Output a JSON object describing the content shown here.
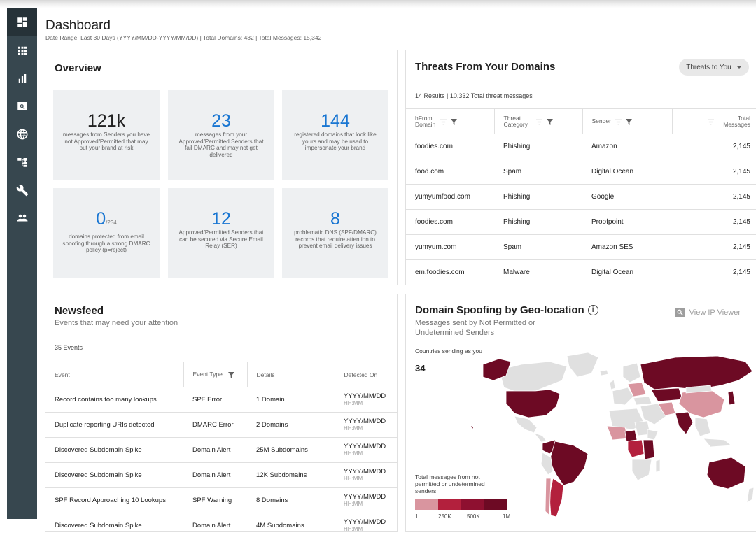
{
  "header": {
    "title": "Dashboard",
    "subtitle": "Date Range: Last 30 Days (YYYY/MM/DD-YYYY/MM/DD) | Total Domains: 432 | Total Messages: 15,342"
  },
  "sidebar": {
    "items": [
      {
        "icon": "dashboard-icon"
      },
      {
        "icon": "grid-icon"
      },
      {
        "icon": "bar-chart-icon"
      },
      {
        "icon": "search-icon"
      },
      {
        "icon": "globe-icon"
      },
      {
        "icon": "sitemap-icon"
      },
      {
        "icon": "wrench-icon"
      },
      {
        "icon": "people-icon"
      }
    ]
  },
  "overview": {
    "title": "Overview",
    "tiles": [
      {
        "value": "121k",
        "suffix": "",
        "desc": "messages from Senders you have not Approved/Permitted that may put your brand at risk"
      },
      {
        "value": "23",
        "suffix": "",
        "desc": "messages from your Approved/Permitted Senders that fail DMARC and may not get delivered"
      },
      {
        "value": "144",
        "suffix": "",
        "desc": "registered domains that look like yours and may be used to impersonate your brand"
      },
      {
        "value": "0",
        "suffix": "/234",
        "desc": "domains protected from email spoofing through a strong DMARC policy (p=reject)"
      },
      {
        "value": "12",
        "suffix": "",
        "desc": "Approved/Permitted Senders that can be secured via Secure Email Relay (SER)"
      },
      {
        "value": "8",
        "suffix": "",
        "desc": "problematic DNS (SPF/DMARC) records that require attention to prevent email delivery issues"
      }
    ]
  },
  "threats": {
    "title": "Threats From Your Domains",
    "dropdown": "Threats to You",
    "results": "14 Results | 10,332 Total threat messages",
    "columns": [
      "hFrom Domain",
      "Threat Category",
      "Sender",
      "Total Messages"
    ],
    "rows": [
      [
        "foodies.com",
        "Phishing",
        "Amazon",
        "2,145"
      ],
      [
        "food.com",
        "Spam",
        "Digital Ocean",
        "2,145"
      ],
      [
        "yumyumfood.com",
        "Phishing",
        "Google",
        "2,145"
      ],
      [
        "foodies.com",
        "Phishing",
        "Proofpoint",
        "2,145"
      ],
      [
        "yumyum.com",
        "Spam",
        "Amazon SES",
        "2,145"
      ],
      [
        "em.foodies.com",
        "Malware",
        "Digital Ocean",
        "2,145"
      ]
    ]
  },
  "newsfeed": {
    "title": "Newsfeed",
    "subtitle": "Events that may need your attention",
    "count": "35 Events",
    "columns": [
      "Event",
      "Event Type",
      "Details",
      "Detected On"
    ],
    "rows": [
      [
        "Record contains too many lookups",
        "SPF Error",
        "1 Domain",
        "YYYY/MM/DD",
        "HH:MM"
      ],
      [
        "Duplicate reporting URIs detected",
        "DMARC Error",
        "2 Domains",
        "YYYY/MM/DD",
        "HH:MM"
      ],
      [
        "Discovered Subdomain Spike",
        "Domain Alert",
        "25M Subdomains",
        "YYYY/MM/DD",
        "HH:MM"
      ],
      [
        "Discovered Subdomain Spike",
        "Domain Alert",
        "12K Subdomains",
        "YYYY/MM/DD",
        "HH:MM"
      ],
      [
        "SPF Record Approaching 10 Lookups",
        "SPF Warning",
        "8 Domains",
        "YYYY/MM/DD",
        "HH:MM"
      ],
      [
        "Discovered Subdomain Spike",
        "Domain Alert",
        "4M Subdomains",
        "YYYY/MM/DD",
        "HH:MM"
      ]
    ]
  },
  "geo": {
    "title": "Domain Spoofing by Geo-location",
    "subtitle": "Messages sent by Not Permitted or Undetermined Senders",
    "view_ip": "View IP Viewer",
    "countries_label": "Countries sending as you",
    "countries_count": "34",
    "legend_label": "Total messages from not permitted or undetermined senders",
    "legend_ticks": [
      "1",
      "250K",
      "500K",
      "1M"
    ],
    "colors": {
      "none": "#e0e0e0",
      "low": "#d9959f",
      "mid": "#b3203d",
      "high": "#6d0a24"
    }
  },
  "colors": {
    "sidebar": "#37474f",
    "accent_blue": "#1976d2",
    "tile_bg": "#eef0f2"
  }
}
